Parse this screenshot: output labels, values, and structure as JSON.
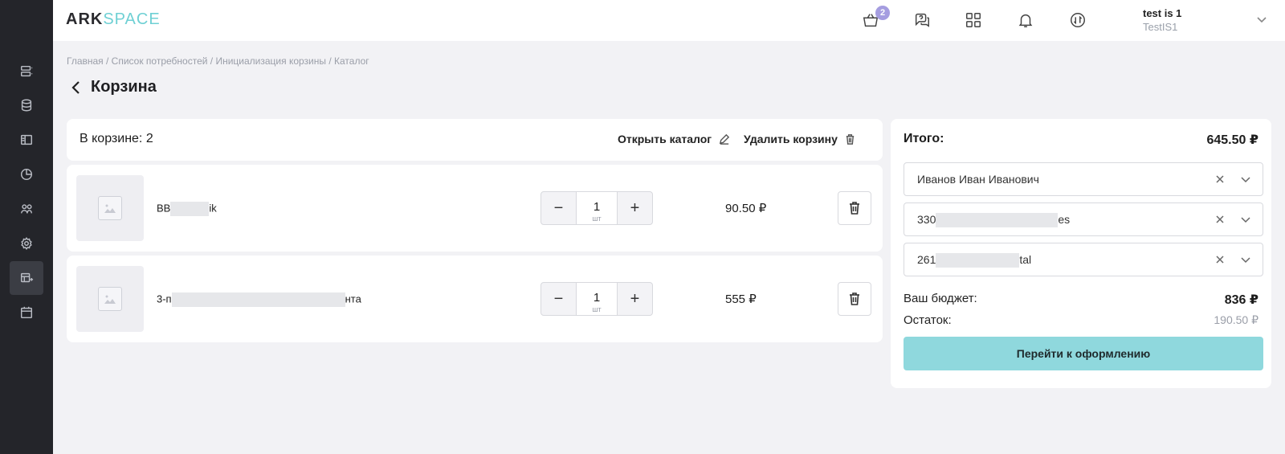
{
  "app": {
    "logo_part1": "ARK",
    "logo_part2": "SPACE"
  },
  "header": {
    "cart_badge": "2",
    "user_name": "test is 1",
    "user_org": "TestIS1"
  },
  "sidebar": {
    "items": [
      {
        "icon": "server-icon",
        "active": false
      },
      {
        "icon": "database-icon",
        "active": false
      },
      {
        "icon": "layout-icon",
        "active": false
      },
      {
        "icon": "pie-chart-icon",
        "active": false
      },
      {
        "icon": "users-icon",
        "active": false
      },
      {
        "icon": "gear-icon",
        "active": false
      },
      {
        "icon": "table-cart-icon",
        "active": true
      },
      {
        "icon": "calendar-icon",
        "active": false
      }
    ]
  },
  "breadcrumb": "Главная / Список потребностей / Инициализация корзины / Каталог",
  "page_title": "Корзина",
  "cart": {
    "count_label": "В корзине: 2",
    "open_catalog": "Открыть каталог",
    "delete_cart": "Удалить корзину",
    "items": [
      {
        "name_start": "BB",
        "name_end": "ik",
        "qty": "1",
        "unit": "шт",
        "price": "90.50 ₽"
      },
      {
        "name_start": "3-п",
        "name_end": "нта",
        "qty": "1",
        "unit": "шт",
        "price": "555 ₽"
      }
    ]
  },
  "summary": {
    "total_label": "Итого:",
    "total_value": "645.50 ₽",
    "selects": [
      {
        "value_start": "Иванов Иван Иванович",
        "value_end": ""
      },
      {
        "value_start": "330",
        "value_end": "es"
      },
      {
        "value_start": "261",
        "value_end": "tal"
      }
    ],
    "budget_label": "Ваш бюджет:",
    "budget_value": "836 ₽",
    "rest_label": "Остаток:",
    "rest_value": "190.50 ₽",
    "checkout_label": "Перейти к оформлению"
  },
  "colors": {
    "accent": "#8fd8dd",
    "sidebar_bg": "#24252a",
    "badge": "#a59de0"
  }
}
